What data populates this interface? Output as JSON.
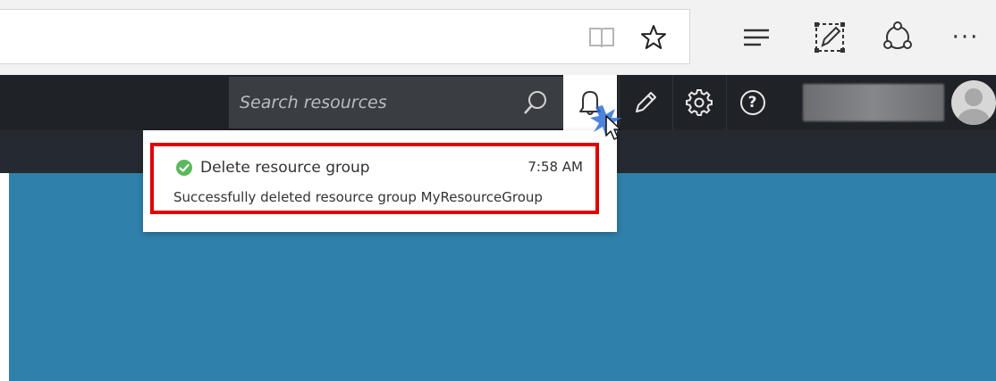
{
  "browser": {
    "icons": {
      "reading_view": "reading-view-icon",
      "favorite": "star-icon",
      "hub": "hub-icon",
      "web_note": "web-note-icon",
      "share": "share-icon",
      "more": "more-icon"
    },
    "more_label": "···"
  },
  "portal": {
    "search": {
      "placeholder": "Search resources"
    },
    "icons": {
      "search": "search-icon",
      "notifications": "bell-icon",
      "edit": "pencil-icon",
      "settings": "gear-icon",
      "help": "help-icon",
      "avatar": "avatar-icon"
    },
    "help_label": "?"
  },
  "notification": {
    "title": "Delete resource group",
    "time": "7:58 AM",
    "message": "Successfully deleted resource group MyResourceGroup",
    "status": "success",
    "status_color": "#5cb85c",
    "highlight_color": "#e00000"
  },
  "colors": {
    "portal_bar": "#1f2227",
    "main_background": "#2f80aa",
    "search_box": "#3a3d42"
  }
}
